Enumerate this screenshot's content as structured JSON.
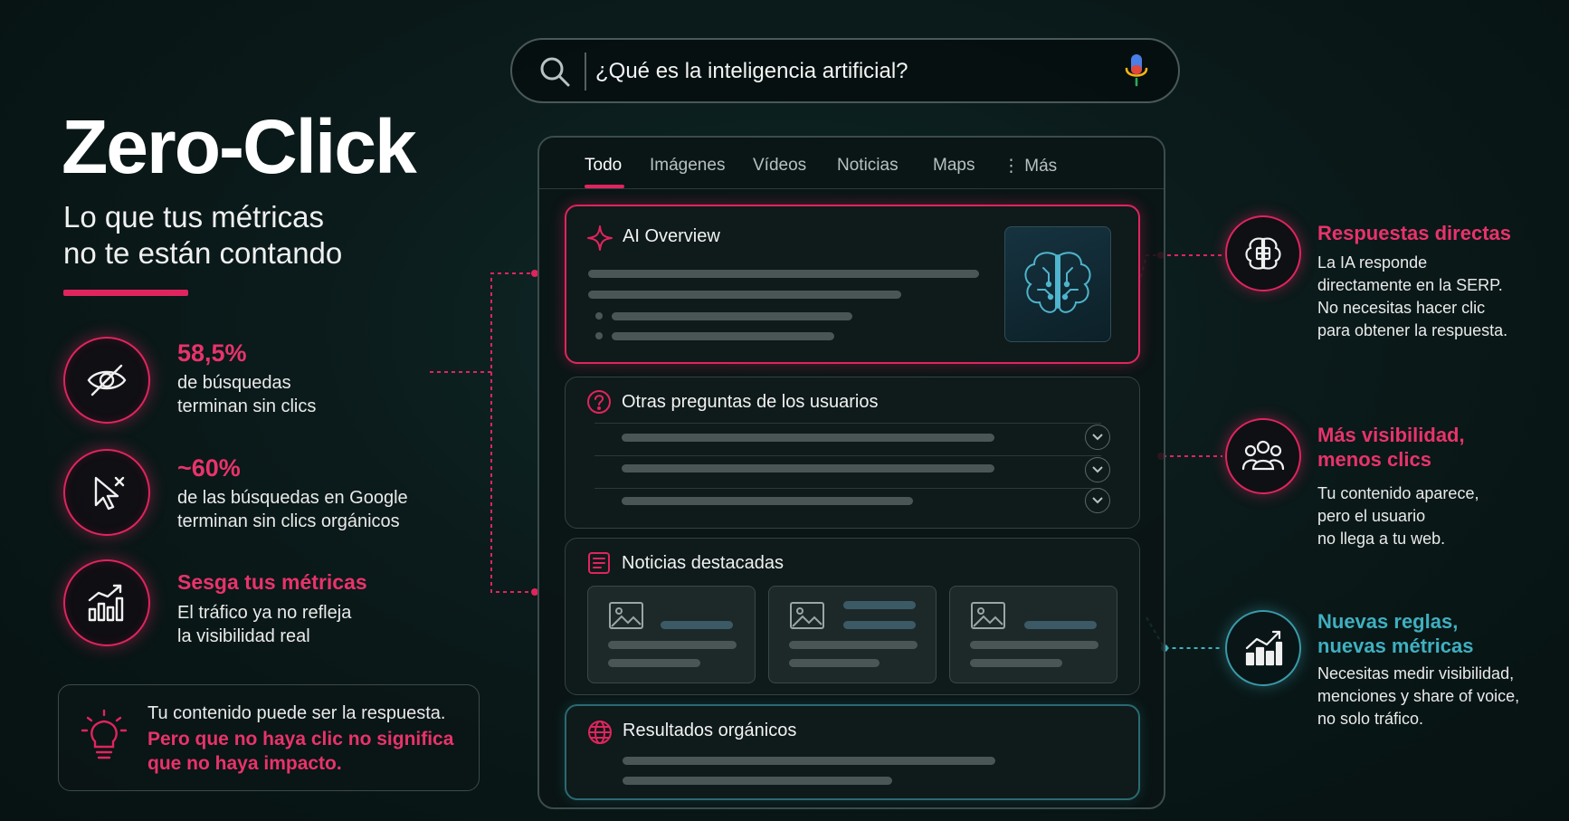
{
  "hero": {
    "title": "Zero-Click",
    "subtitle_line1": "Lo que tus métricas",
    "subtitle_line2": "no te están contando"
  },
  "stats": [
    {
      "icon": "eye-off-icon",
      "value": "58,5%",
      "line1": "de búsquedas",
      "line2": "terminan sin clics"
    },
    {
      "icon": "cursor-x-icon",
      "value": "~60%",
      "line1": "de las búsquedas en Google",
      "line2": "terminan sin clics orgánicos"
    },
    {
      "icon": "bar-chart-trend-icon",
      "value": "Sesga tus métricas",
      "line1": "El tráfico ya no refleja",
      "line2": "la visibilidad real"
    }
  ],
  "tip": {
    "icon": "lightbulb-icon",
    "line1": "Tu contenido puede ser la respuesta.",
    "line2": "Pero que no haya clic no significa",
    "line3": "que no haya impacto."
  },
  "search": {
    "query": "¿Qué es la inteligencia artificial?",
    "icons": [
      "search-icon",
      "microphone-icon"
    ]
  },
  "serp": {
    "tabs": [
      "Todo",
      "Imágenes",
      "Vídeos",
      "Noticias",
      "Maps",
      "⋮ Más"
    ],
    "active_tab": "Todo",
    "ai_overview": {
      "title": "AI Overview"
    },
    "people_also_ask": {
      "title": "Otras preguntas de los usuarios"
    },
    "top_news": {
      "title": "Noticias destacadas"
    },
    "organic": {
      "title": "Resultados orgánicos"
    }
  },
  "benefits": [
    {
      "icon": "ai-chip-brain-icon",
      "color": "#e8336b",
      "title_line1": "Respuestas directas",
      "title_line2": "",
      "lines": [
        "La IA responde",
        "directamente en la SERP.",
        "No necesitas hacer clic",
        "para obtener la respuesta."
      ]
    },
    {
      "icon": "users-group-icon",
      "color": "#e8336b",
      "title_line1": "Más visibilidad,",
      "title_line2": "menos clics",
      "lines": [
        "Tu contenido aparece,",
        "pero el usuario",
        "no llega a tu web."
      ]
    },
    {
      "icon": "growth-chart-icon",
      "color": "#3fb0c0",
      "title_line1": "Nuevas reglas,",
      "title_line2": "nuevas métricas",
      "lines": [
        "Necesitas medir visibilidad,",
        "menciones y share of voice,",
        "no solo tráfico."
      ]
    }
  ],
  "colors": {
    "accent_pink": "#e0245e",
    "accent_teal": "#3fb0c0",
    "background": "#0b1a1a"
  }
}
